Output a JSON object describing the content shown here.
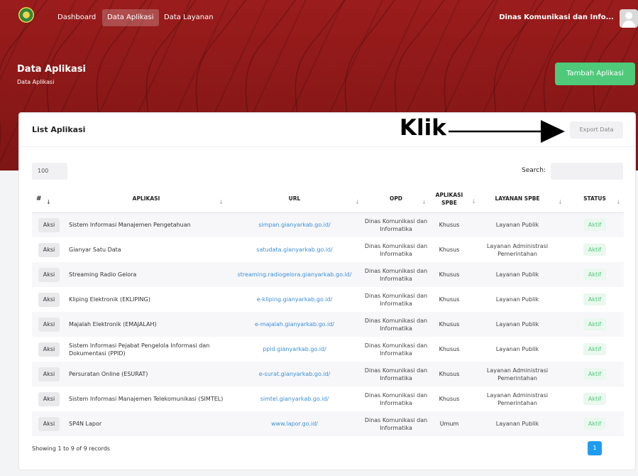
{
  "nav": {
    "items": [
      "Dashboard",
      "Data Aplikasi",
      "Data Layanan"
    ],
    "active": "Data Aplikasi",
    "user_name": "Dinas Komunikasi dan Info..."
  },
  "header": {
    "title": "Data Aplikasi",
    "breadcrumb": "Data Aplikasi",
    "add_button": "Tambah Aplikasi"
  },
  "card": {
    "title": "List Aplikasi",
    "annotation": "Klik",
    "export_button": "Export Data",
    "page_length": "100",
    "search_label": "Search:",
    "search_value": ""
  },
  "table": {
    "columns": [
      "#",
      "APLIKASI",
      "URL",
      "OPD",
      "APLIKASI SPBE",
      "LAYANAN SPBE",
      "STATUS"
    ],
    "rows": [
      {
        "action": "Aksi",
        "app": "Sistem Informasi Manajemen Pengetahuan",
        "url": "simpan.gianyarkab.go.id/",
        "opd": "Dinas Komunikasi dan Informatika",
        "spbe": "Khusus",
        "layanan": "Layanan Publik",
        "status": "Aktif"
      },
      {
        "action": "Aksi",
        "app": "Gianyar Satu Data",
        "url": "satudata.gianyarkab.go.id/",
        "opd": "Dinas Komunikasi dan Informatika",
        "spbe": "Khusus",
        "layanan": "Layanan Administrasi Pemerintahan",
        "status": "Aktif"
      },
      {
        "action": "Aksi",
        "app": "Streaming Radio Gelora",
        "url": "streaming.radiogelora.gianyarkab.go.id/",
        "opd": "Dinas Komunikasi dan Informatika",
        "spbe": "Khusus",
        "layanan": "Layanan Publik",
        "status": "Aktif"
      },
      {
        "action": "Aksi",
        "app": "Kliping Elektronik (EKLIPING)",
        "url": "e-kliping.gianyarkab.go.id/",
        "opd": "Dinas Komunikasi dan Informatika",
        "spbe": "Khusus",
        "layanan": "Layanan Publik",
        "status": "Aktif"
      },
      {
        "action": "Aksi",
        "app": "Majalah Elektronik (EMAJALAH)",
        "url": "e-majalah.gianyarkab.go.id/",
        "opd": "Dinas Komunikasi dan Informatika",
        "spbe": "Khusus",
        "layanan": "Layanan Publik",
        "status": "Aktif"
      },
      {
        "action": "Aksi",
        "app": "Sistem Informasi Pejabat Pengelola Informasi dan Dokumentasi (PPID)",
        "url": "ppid.gianyarkab.go.id/",
        "opd": "Dinas Komunikasi dan Informatika",
        "spbe": "Khusus",
        "layanan": "Layanan Publik",
        "status": "Aktif"
      },
      {
        "action": "Aksi",
        "app": "Persuratan Online (ESURAT)",
        "url": "e-surat.gianyarkab.go.id/",
        "opd": "Dinas Komunikasi dan Informatika",
        "spbe": "Khusus",
        "layanan": "Layanan Administrasi Pemerintahan",
        "status": "Aktif"
      },
      {
        "action": "Aksi",
        "app": "Sistem Informasi Manajemen Telekomunikasi (SIMTEL)",
        "url": "simtel.gianyarkab.go.id/",
        "opd": "Dinas Komunikasi dan Informatika",
        "spbe": "Khusus",
        "layanan": "Layanan Administrasi Pemerintahan",
        "status": "Aktif"
      },
      {
        "action": "Aksi",
        "app": "SP4N Lapor",
        "url": "www.lapor.go.id/",
        "opd": "Dinas Komunikasi dan Informatika",
        "spbe": "Umum",
        "layanan": "Layanan Publik",
        "status": "Aktif"
      }
    ]
  },
  "footer": {
    "info": "Showing 1 to 9 of 9 records",
    "current_page": "1"
  },
  "colors": {
    "brand_red": "#8e1a1a",
    "accent_green": "#4fc97a",
    "link_blue": "#3b8fd6",
    "page_blue": "#1f9cf0"
  }
}
